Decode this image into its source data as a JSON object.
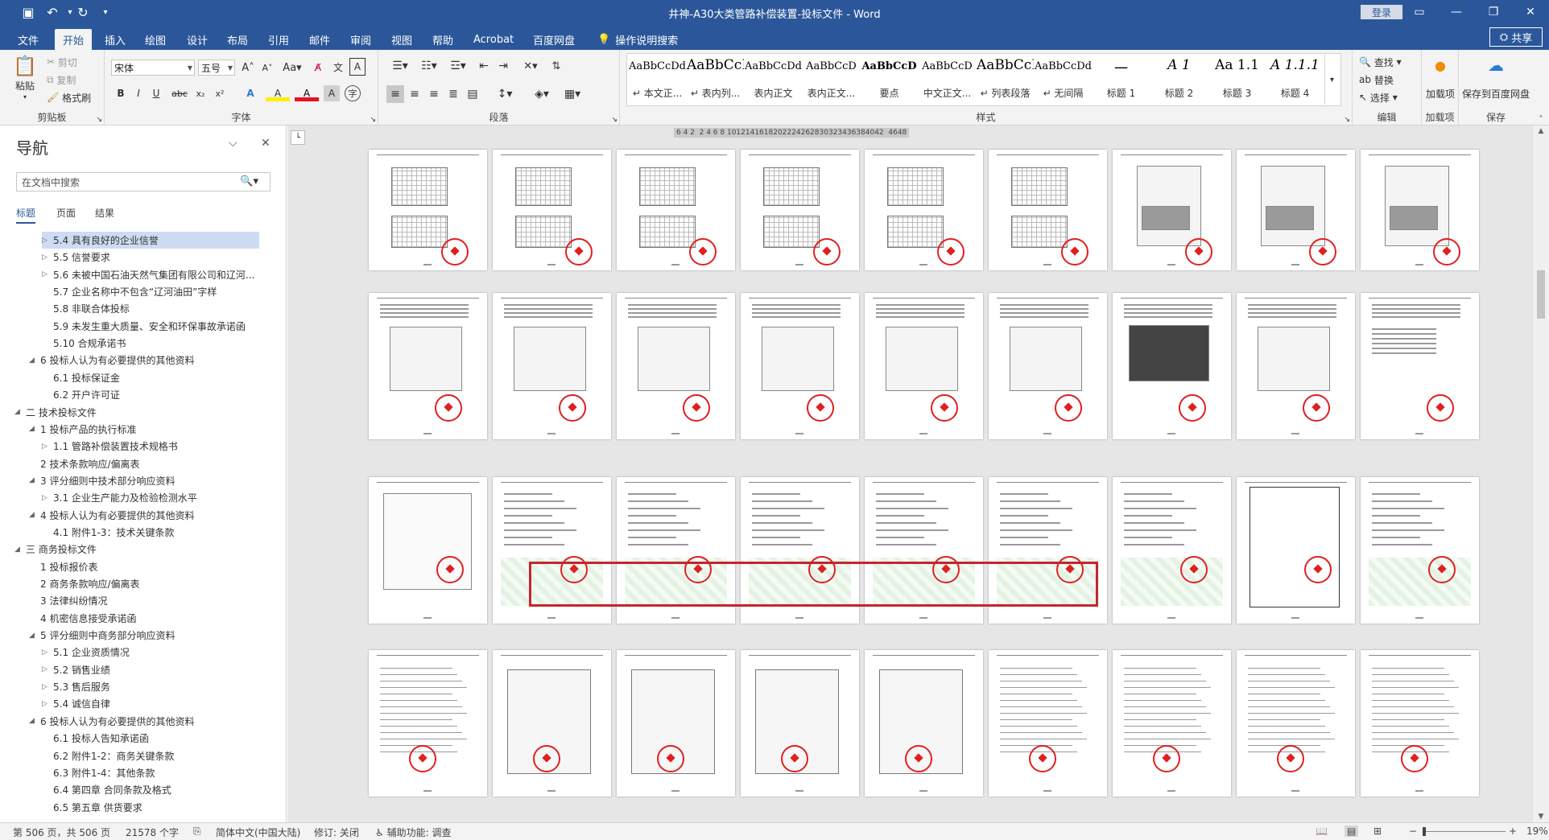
{
  "titlebar": {
    "title": "井神-A30大类管路补偿装置-投标文件  -  Word",
    "login": "登录",
    "save_icon": "save-icon",
    "undo_icon": "undo-icon",
    "redo_icon": "redo-icon",
    "customize_icon": "chevron-down-icon"
  },
  "ribbon_tabs": [
    "文件",
    "开始",
    "插入",
    "绘图",
    "设计",
    "布局",
    "引用",
    "邮件",
    "审阅",
    "视图",
    "帮助",
    "Acrobat",
    "百度网盘"
  ],
  "active_tab": "开始",
  "tell_me": "操作说明搜索",
  "share": "共享",
  "clipboard": {
    "paste": "粘贴",
    "cut": "剪切",
    "copy": "复制",
    "format_painter": "格式刷",
    "label": "剪贴板"
  },
  "font": {
    "name": "宋体",
    "size": "五号",
    "label": "字体",
    "buttons": [
      "B",
      "I",
      "U",
      "abc",
      "x₂",
      "x²",
      "A",
      "A",
      "A",
      "A"
    ]
  },
  "paragraph": {
    "label": "段落"
  },
  "styles": {
    "label": "样式",
    "items": [
      {
        "sample": "AaBbCcDdI",
        "name": "↵ 本文正..."
      },
      {
        "sample": "AaBbCcD",
        "name": "↵ 表内列..."
      },
      {
        "sample": "AaBbCcDdI",
        "name": "表内正文"
      },
      {
        "sample": "AaBbCcD",
        "name": "表内正文..."
      },
      {
        "sample": "AaBbCcD",
        "name": "要点"
      },
      {
        "sample": "AaBbCcD",
        "name": "中文正文..."
      },
      {
        "sample": "AaBbCcI",
        "name": "↵ 列表段落"
      },
      {
        "sample": "AaBbCcDdI",
        "name": "↵ 无间隔"
      },
      {
        "sample": "一",
        "name": "标题 1"
      },
      {
        "sample": "A 1",
        "name": "标题 2"
      },
      {
        "sample": "Aa 1.1",
        "name": "标题 3"
      },
      {
        "sample": "A 1.1.1",
        "name": "标题 4"
      }
    ]
  },
  "editing": {
    "find": "查找",
    "replace": "替换",
    "select": "选择",
    "label": "编辑"
  },
  "addins": {
    "load": "加载项",
    "label": "加载项"
  },
  "save_group": {
    "save_baidu": "保存到百度网盘",
    "label": "保存"
  },
  "nav": {
    "title": "导航",
    "search_placeholder": "在文档中搜索",
    "tabs": [
      "标题",
      "页面",
      "结果"
    ],
    "items": [
      {
        "text": "5.4 具有良好的企业信誉",
        "level": 3,
        "tri": "▷",
        "selected": true
      },
      {
        "text": "5.5 信誉要求",
        "level": 3,
        "tri": "▷"
      },
      {
        "text": "5.6 未被中国石油天然气集团有限公司和辽河...",
        "level": 3,
        "tri": "▷"
      },
      {
        "text": "5.7 企业名称中不包含“辽河油田”字样",
        "level": 3,
        "tri": ""
      },
      {
        "text": "5.8 非联合体投标",
        "level": 3,
        "tri": ""
      },
      {
        "text": "5.9 未发生重大质量、安全和环保事故承诺函",
        "level": 3,
        "tri": ""
      },
      {
        "text": "5.10 合规承诺书",
        "level": 3,
        "tri": ""
      },
      {
        "text": "6 投标人认为有必要提供的其他资料",
        "level": 2,
        "tri": "◢"
      },
      {
        "text": "6.1 投标保证金",
        "level": 3,
        "tri": ""
      },
      {
        "text": "6.2 开户许可证",
        "level": 3,
        "tri": ""
      },
      {
        "text": "二 技术投标文件",
        "level": 1,
        "tri": "◢"
      },
      {
        "text": "1 投标产品的执行标准",
        "level": 2,
        "tri": "◢"
      },
      {
        "text": "1.1 管路补偿装置技术规格书",
        "level": 3,
        "tri": "▷"
      },
      {
        "text": "2 技术条款响应/偏离表",
        "level": 2,
        "tri": ""
      },
      {
        "text": "3 评分细则中技术部分响应资料",
        "level": 2,
        "tri": "◢"
      },
      {
        "text": "3.1 企业生产能力及检验检测水平",
        "level": 3,
        "tri": "▷"
      },
      {
        "text": "4 投标人认为有必要提供的其他资料",
        "level": 2,
        "tri": "◢"
      },
      {
        "text": "4.1 附件1-3：技术关键条款",
        "level": 3,
        "tri": ""
      },
      {
        "text": "三 商务投标文件",
        "level": 1,
        "tri": "◢"
      },
      {
        "text": "1 投标报价表",
        "level": 2,
        "tri": ""
      },
      {
        "text": "2 商务条款响应/偏离表",
        "level": 2,
        "tri": ""
      },
      {
        "text": "3 法律纠纷情况",
        "level": 2,
        "tri": ""
      },
      {
        "text": "4 机密信息接受承诺函",
        "level": 2,
        "tri": ""
      },
      {
        "text": "5 评分细则中商务部分响应资料",
        "level": 2,
        "tri": "◢"
      },
      {
        "text": "5.1 企业资质情况",
        "level": 3,
        "tri": "▷"
      },
      {
        "text": "5.2 销售业绩",
        "level": 3,
        "tri": "▷"
      },
      {
        "text": "5.3 售后服务",
        "level": 3,
        "tri": "▷"
      },
      {
        "text": "5.4 诚信自律",
        "level": 3,
        "tri": "▷"
      },
      {
        "text": "6 投标人认为有必要提供的其他资料",
        "level": 2,
        "tri": "◢"
      },
      {
        "text": "6.1 投标人告知承诺函",
        "level": 3,
        "tri": ""
      },
      {
        "text": "6.2 附件1-2：商务关键条款",
        "level": 3,
        "tri": ""
      },
      {
        "text": "6.3 附件1-4：其他条款",
        "level": 3,
        "tri": ""
      },
      {
        "text": "6.4 第四章 合同条款及格式",
        "level": 3,
        "tri": ""
      },
      {
        "text": "6.5 第五章 供货要求",
        "level": 3,
        "tri": ""
      }
    ]
  },
  "ruler_text": "6 4 2  2 4 6 8 1012141618202224262830323436384042  4648",
  "status": {
    "page": "第 506 页，共 506 页",
    "words": "21578 个字",
    "language": "简体中文(中国大陆)",
    "track_changes": "修订: 关闭",
    "accessibility": "辅助功能: 调查",
    "zoom": "19%"
  }
}
